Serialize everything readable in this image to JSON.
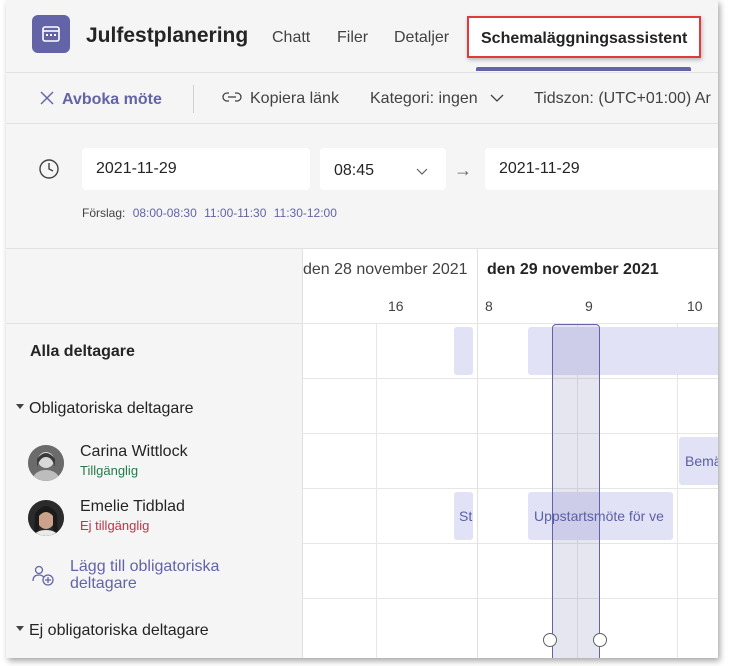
{
  "header": {
    "title": "Julfestplanering",
    "tabs": [
      {
        "label": "Chatt"
      },
      {
        "label": "Filer"
      },
      {
        "label": "Detaljer"
      },
      {
        "label": "Schemaläggningsassistent",
        "active": true
      }
    ]
  },
  "toolbar": {
    "cancel_label": "Avboka möte",
    "copy_link_label": "Kopiera länk",
    "category_label": "Kategori: ingen",
    "timezone_label": "Tidszon: (UTC+01:00) Ar"
  },
  "datetime": {
    "start_date": "2021-11-29",
    "start_time": "08:45",
    "end_date": "2021-11-29",
    "suggestions_label": "Förslag:",
    "suggestions": [
      "08:00-08:30",
      "11:00-11:30",
      "11:30-12:00"
    ]
  },
  "schedule": {
    "prev_date": "den 28 november 2021",
    "current_date": "den 29 november 2021",
    "hours": [
      "16",
      "8",
      "9",
      "10"
    ],
    "all_attendees_label": "Alla deltagare",
    "required_group_label": "Obligatoriska deltagare",
    "optional_group_label": "Ej obligatoriska deltagare",
    "add_required_label_line1": "Lägg till obligatoriska",
    "add_required_label_line2": "deltagare",
    "attendees": [
      {
        "name": "Carina Wittlock",
        "status": "Tillgänglig",
        "status_color": "#237b4b"
      },
      {
        "name": "Emelie Tidblad",
        "status": "Ej tillgänglig",
        "status_color": "#c4314b"
      }
    ],
    "events": {
      "carina_event": "Bemä",
      "emelie_event_short": "St",
      "emelie_event": "Uppstartsmöte för ve"
    }
  },
  "colors": {
    "accent": "#6264a7",
    "highlight_border": "#e03a3a",
    "busy_fill": "#e2e2f6"
  }
}
